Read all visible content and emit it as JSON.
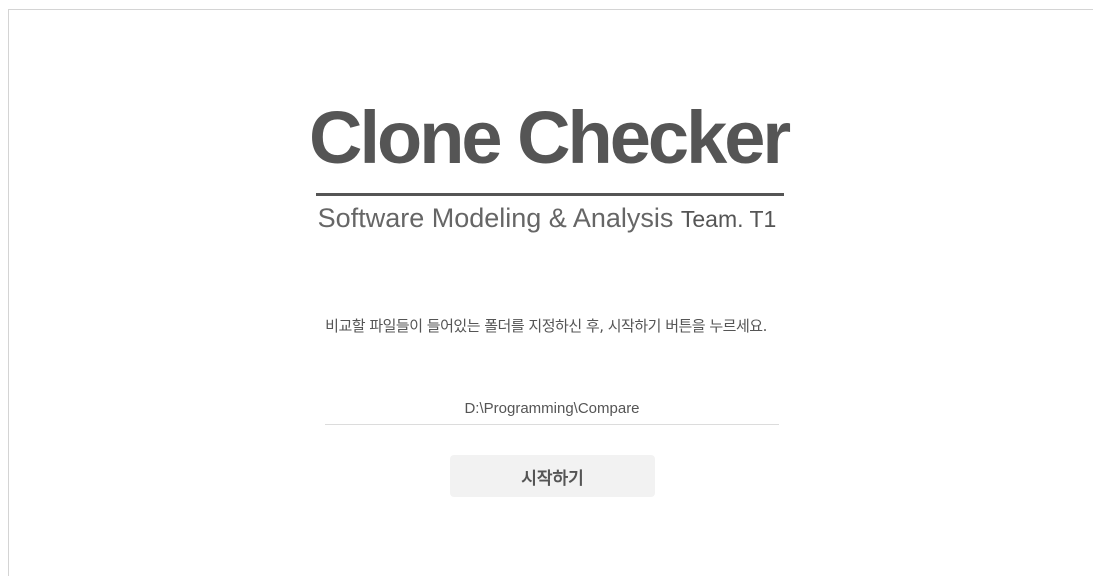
{
  "app": {
    "title": "Clone Checker",
    "subtitle": "Software Modeling & Analysis",
    "team": "Team. T1"
  },
  "main": {
    "instruction": "비교할 파일들이 들어있는 폴더를 지정하신 후, 시작하기 버튼을 누르세요.",
    "folder_path": "D:\\Programming\\Compare",
    "start_label": "시작하기"
  }
}
